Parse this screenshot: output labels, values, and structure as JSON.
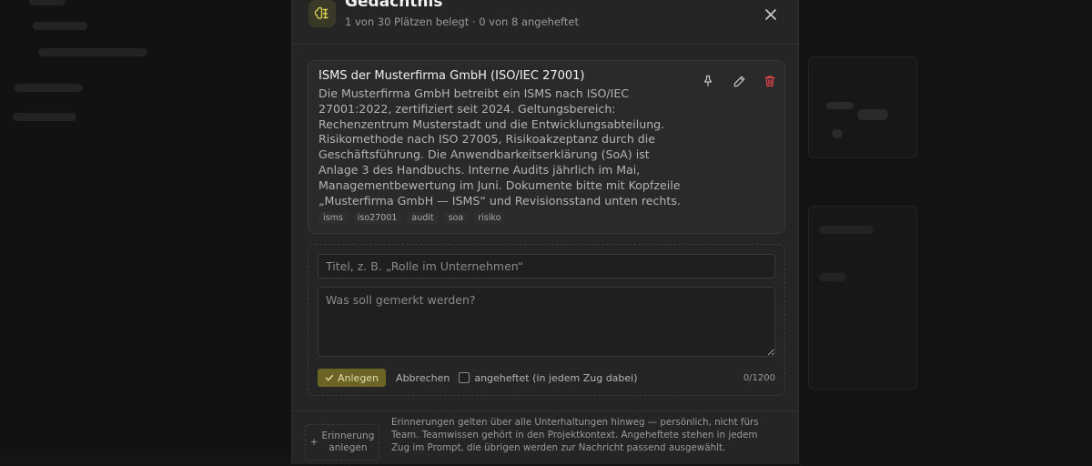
{
  "modal": {
    "title": "Gedächtnis",
    "subtitle": "1 von 30 Plätzen belegt · 0 von 8 angeheftet",
    "icon": "brain-icon",
    "close_icon": "close-icon"
  },
  "memories": [
    {
      "title": "ISMS der Musterfirma GmbH (ISO/IEC 27001)",
      "body": "Die Musterfirma GmbH betreibt ein ISMS nach ISO/IEC 27001:2022, zertifiziert seit 2024. Geltungsbereich: Rechenzentrum Musterstadt und die Entwicklungsabteilung. Risikomethode nach ISO 27005, Risikoakzeptanz durch die Geschäftsführung. Die Anwendbarkeitserklärung (SoA) ist Anlage 3 des Handbuchs. Interne Audits jährlich im Mai, Managementbewertung im Juni. Dokumente bitte mit Kopfzeile „Musterfirma GmbH — ISMS“ und Revisionsstand unten rechts.",
      "tags": [
        "isms",
        "iso27001",
        "audit",
        "soa",
        "risiko"
      ],
      "actions": [
        "pin-icon",
        "edit-icon",
        "trash-icon"
      ]
    }
  ],
  "form": {
    "title_placeholder": "Titel, z. B. „Rolle im Unternehmen“",
    "content_placeholder": "Was soll gemerkt werden?",
    "create_label": "Anlegen",
    "cancel_label": "Abbrechen",
    "pin_label": "angeheftet (in jedem Zug dabei)",
    "counter": "0/1200"
  },
  "footer": {
    "add_label_line1": "Erinnerung",
    "add_label_line2": "anlegen",
    "info": "Erinnerungen gelten über alle Unterhaltungen hinweg — persönlich, nicht fürs Team. Teamwissen gehört in den Projektkontext. Angeheftete stehen in jedem Zug im Prompt, die übrigen werden zur Nachricht passend ausgewählt."
  },
  "colors": {
    "accent": "#6b6424",
    "danger": "#e0454a",
    "modal_bg": "#252525",
    "card_bg": "#2a2a2a"
  }
}
